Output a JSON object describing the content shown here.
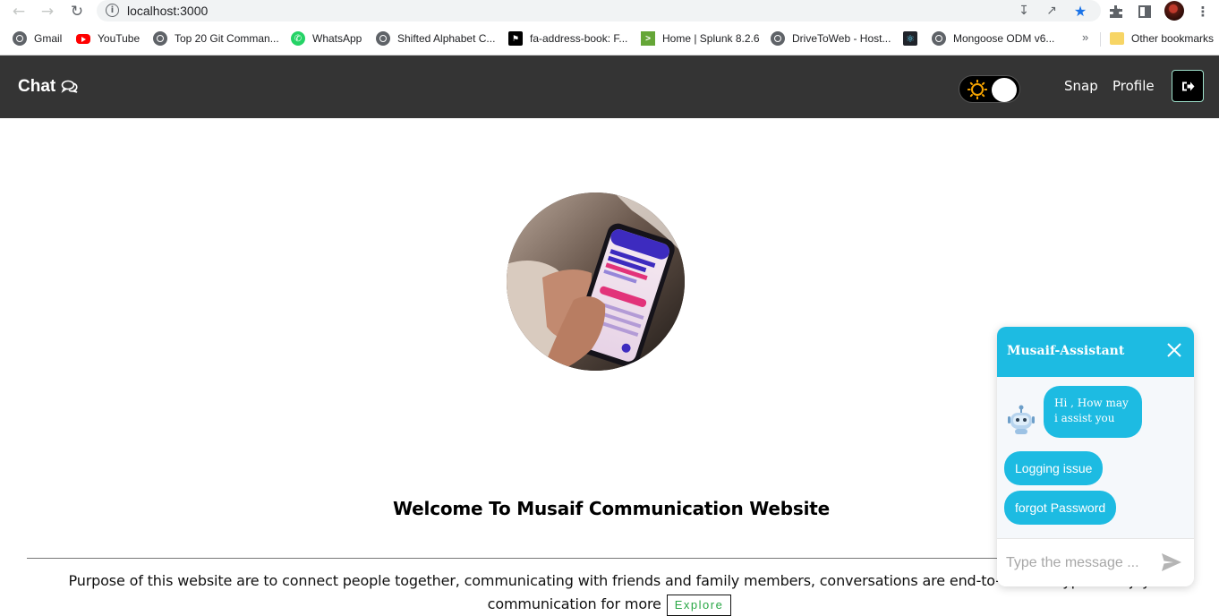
{
  "browser": {
    "url": "localhost:3000",
    "bookmarks": [
      {
        "label": "Gmail",
        "icon": "globe-icon"
      },
      {
        "label": "YouTube",
        "icon": "youtube-icon"
      },
      {
        "label": "Top 20 Git Comman...",
        "icon": "globe-icon"
      },
      {
        "label": "WhatsApp",
        "icon": "whatsapp-icon"
      },
      {
        "label": "Shifted Alphabet C...",
        "icon": "globe-icon"
      },
      {
        "label": "fa-address-book: F...",
        "icon": "font-awesome-icon"
      },
      {
        "label": "Home | Splunk 8.2.6",
        "icon": "splunk-icon"
      },
      {
        "label": "DriveToWeb - Host...",
        "icon": "globe-icon"
      },
      {
        "label": "",
        "icon": "react-icon"
      },
      {
        "label": "Mongoose ODM v6...",
        "icon": "globe-icon"
      }
    ],
    "overflow_chevron": "»",
    "other_bookmarks": "Other bookmarks"
  },
  "navbar": {
    "brand": "Chat",
    "brand_icon": "comments-icon",
    "links": [
      "Snap",
      "Profile"
    ],
    "theme_toggle": "sun-icon",
    "logout_icon": "sign-out-icon"
  },
  "main": {
    "hero_image": "phone-in-hand-image",
    "welcome": "Welcome To Musaif Communication Website",
    "purpose_line1": "Purpose of this website are to connect people together, communicating with friends and family members, conversations are end-to-end encrypted. Enjoy",
    "purpose_line2": "communication for more",
    "explore": "Explore"
  },
  "chatbot": {
    "title": "Musaif-Assistant",
    "greeting": "Hi , How may i assist you",
    "options": [
      "Logging issue",
      "forgot Password"
    ],
    "input_placeholder": "Type the message ...",
    "accent_color": "#1dbbe2"
  },
  "colors": {
    "navbar_bg": "#343434",
    "explore_text": "#28a745"
  }
}
